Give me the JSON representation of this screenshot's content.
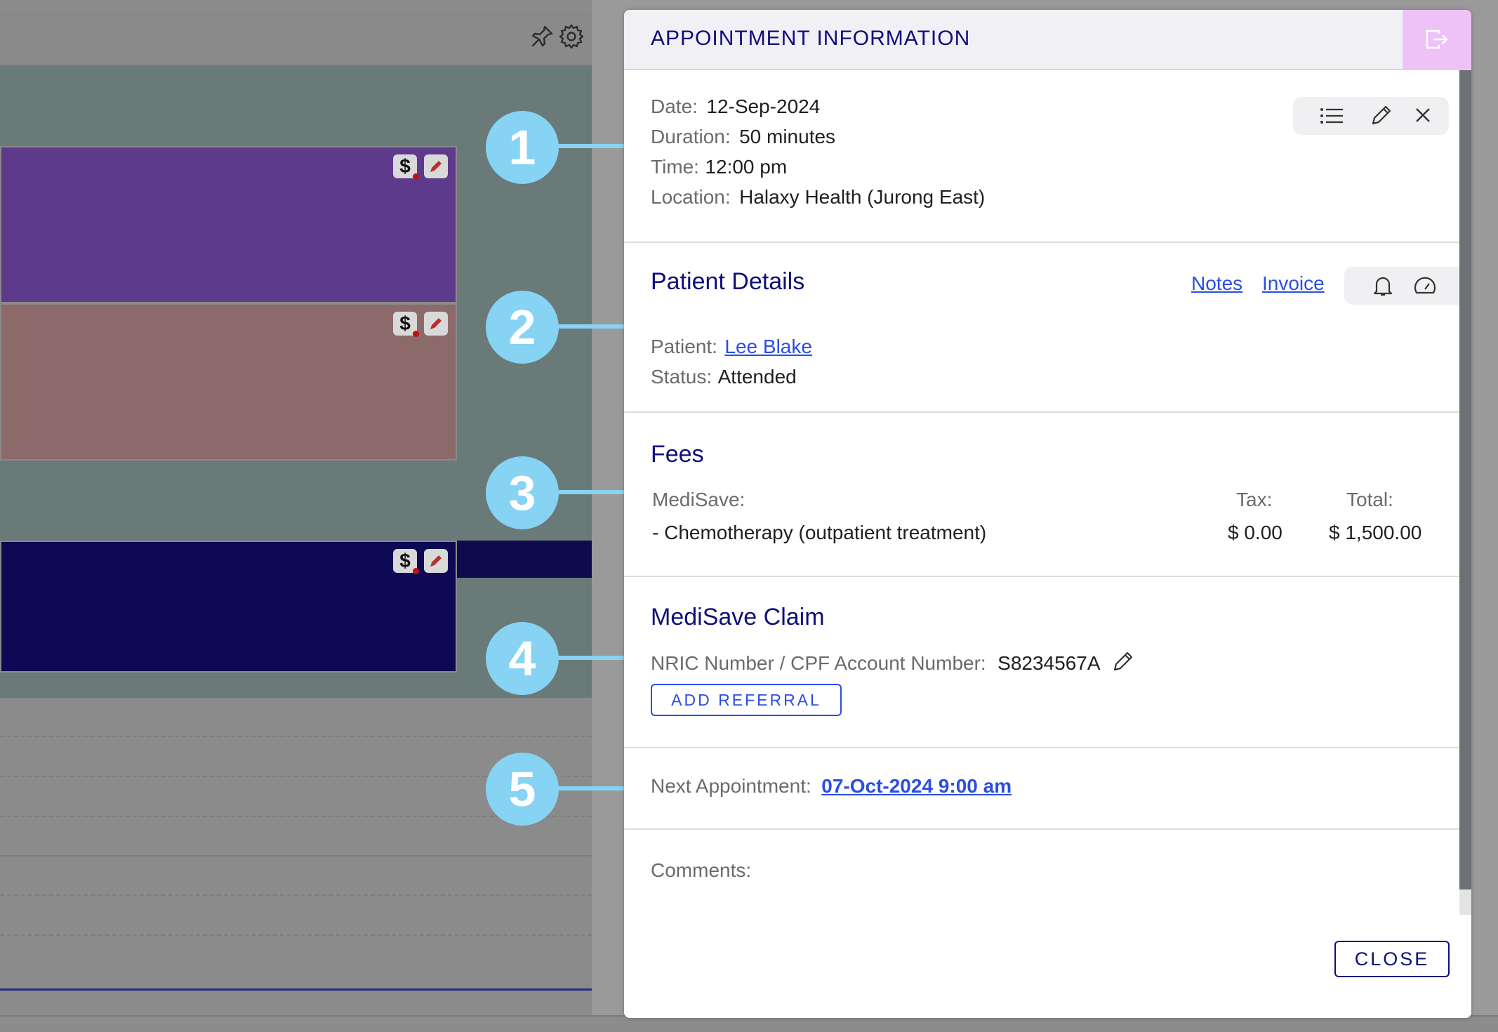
{
  "calendar": {
    "toolbar_icons": [
      "pin-icon",
      "gear-icon"
    ],
    "appointments": [
      {
        "color": "#5e3a8c",
        "icons": [
          "dollar-icon",
          "pencil-icon"
        ]
      },
      {
        "color": "#8c6a6a",
        "icons": [
          "dollar-icon",
          "pencil-icon"
        ]
      },
      {
        "color": "#0e0a4e",
        "icons": [
          "dollar-icon",
          "pencil-icon"
        ]
      }
    ]
  },
  "callouts": [
    "1",
    "2",
    "3",
    "4",
    "5"
  ],
  "dialog": {
    "title": "APPOINTMENT INFORMATION",
    "exit_icon": "exit-icon",
    "appointment": {
      "date_label": "Date:",
      "date_value": "12-Sep-2024",
      "duration_label": "Duration:",
      "duration_value": "50 minutes",
      "time_label": "Time:",
      "time_value": "12:00 pm",
      "location_label": "Location:",
      "location_value": "Halaxy Health (Jurong East)",
      "tools": [
        "list-icon",
        "pencil-icon",
        "close-icon"
      ]
    },
    "patient": {
      "title": "Patient Details",
      "notes_link": "Notes",
      "invoice_link": "Invoice",
      "tools": [
        "bell-icon",
        "gauge-icon"
      ],
      "patient_label": "Patient:",
      "patient_name": "Lee Blake",
      "status_label": "Status:",
      "status_value": "Attended"
    },
    "fees": {
      "title": "Fees",
      "fund_label": "MediSave:",
      "tax_header": "Tax:",
      "total_header": "Total:",
      "items": [
        {
          "name": "- Chemotherapy (outpatient treatment)",
          "tax": "$ 0.00",
          "total": "$ 1,500.00"
        }
      ]
    },
    "claim": {
      "title": "MediSave Claim",
      "nric_label": "NRIC Number / CPF Account Number:",
      "nric_value": "S8234567A",
      "add_referral": "ADD REFERRAL"
    },
    "next": {
      "label": "Next Appointment:",
      "value": "07-Oct-2024 9:00 am"
    },
    "comments_label": "Comments:",
    "close_button": "CLOSE"
  }
}
